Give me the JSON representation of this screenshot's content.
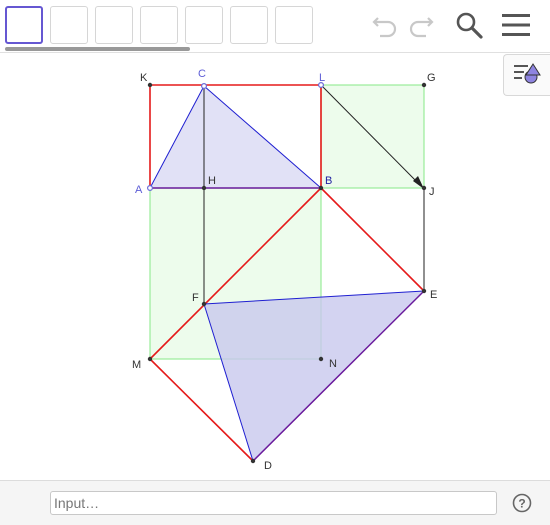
{
  "toolbar": {
    "tools": [
      "",
      "",
      "",
      "",
      "",
      "",
      ""
    ],
    "active_index": 0,
    "icons": [
      "undo-icon",
      "redo-icon",
      "search-icon",
      "menu-icon"
    ]
  },
  "style_bar": {
    "icon": "style-bar-toggle-icon"
  },
  "points": {
    "A": "A",
    "B": "B",
    "C": "C",
    "D": "D",
    "E": "E",
    "F": "F",
    "G": "G",
    "H": "H",
    "J": "J",
    "K": "K",
    "L": "L",
    "M": "M",
    "N": "N"
  },
  "input": {
    "placeholder": "Input…"
  },
  "colors": {
    "accent": "#6557d2",
    "red": "#e51a1a",
    "blue": "#1f1fd1",
    "purple": "#6a1a9c",
    "green_fill": "#edfcec",
    "green_line": "#99ec99",
    "blue_fill": "#dcdcf5"
  }
}
